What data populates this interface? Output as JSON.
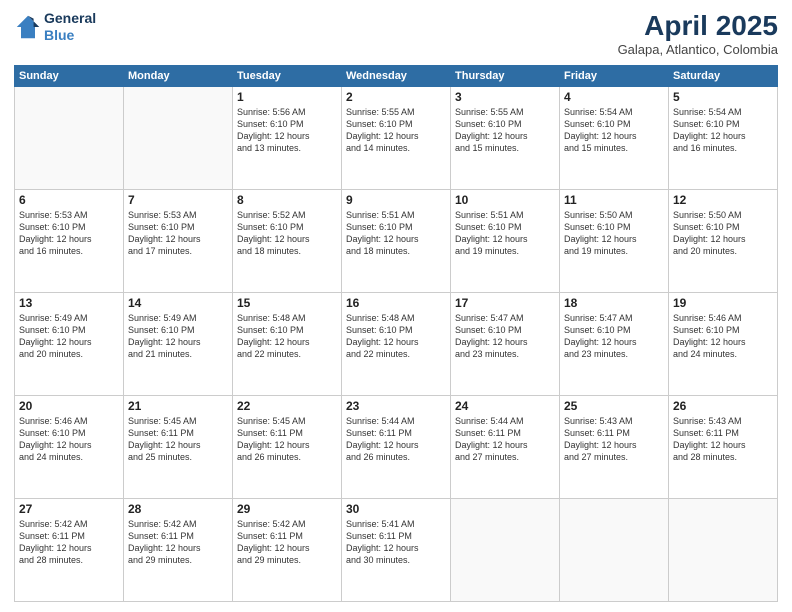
{
  "header": {
    "logo_line1": "General",
    "logo_line2": "Blue",
    "month": "April 2025",
    "location": "Galapa, Atlantico, Colombia"
  },
  "days_of_week": [
    "Sunday",
    "Monday",
    "Tuesday",
    "Wednesday",
    "Thursday",
    "Friday",
    "Saturday"
  ],
  "weeks": [
    [
      {
        "day": "",
        "info": ""
      },
      {
        "day": "",
        "info": ""
      },
      {
        "day": "1",
        "info": "Sunrise: 5:56 AM\nSunset: 6:10 PM\nDaylight: 12 hours\nand 13 minutes."
      },
      {
        "day": "2",
        "info": "Sunrise: 5:55 AM\nSunset: 6:10 PM\nDaylight: 12 hours\nand 14 minutes."
      },
      {
        "day": "3",
        "info": "Sunrise: 5:55 AM\nSunset: 6:10 PM\nDaylight: 12 hours\nand 15 minutes."
      },
      {
        "day": "4",
        "info": "Sunrise: 5:54 AM\nSunset: 6:10 PM\nDaylight: 12 hours\nand 15 minutes."
      },
      {
        "day": "5",
        "info": "Sunrise: 5:54 AM\nSunset: 6:10 PM\nDaylight: 12 hours\nand 16 minutes."
      }
    ],
    [
      {
        "day": "6",
        "info": "Sunrise: 5:53 AM\nSunset: 6:10 PM\nDaylight: 12 hours\nand 16 minutes."
      },
      {
        "day": "7",
        "info": "Sunrise: 5:53 AM\nSunset: 6:10 PM\nDaylight: 12 hours\nand 17 minutes."
      },
      {
        "day": "8",
        "info": "Sunrise: 5:52 AM\nSunset: 6:10 PM\nDaylight: 12 hours\nand 18 minutes."
      },
      {
        "day": "9",
        "info": "Sunrise: 5:51 AM\nSunset: 6:10 PM\nDaylight: 12 hours\nand 18 minutes."
      },
      {
        "day": "10",
        "info": "Sunrise: 5:51 AM\nSunset: 6:10 PM\nDaylight: 12 hours\nand 19 minutes."
      },
      {
        "day": "11",
        "info": "Sunrise: 5:50 AM\nSunset: 6:10 PM\nDaylight: 12 hours\nand 19 minutes."
      },
      {
        "day": "12",
        "info": "Sunrise: 5:50 AM\nSunset: 6:10 PM\nDaylight: 12 hours\nand 20 minutes."
      }
    ],
    [
      {
        "day": "13",
        "info": "Sunrise: 5:49 AM\nSunset: 6:10 PM\nDaylight: 12 hours\nand 20 minutes."
      },
      {
        "day": "14",
        "info": "Sunrise: 5:49 AM\nSunset: 6:10 PM\nDaylight: 12 hours\nand 21 minutes."
      },
      {
        "day": "15",
        "info": "Sunrise: 5:48 AM\nSunset: 6:10 PM\nDaylight: 12 hours\nand 22 minutes."
      },
      {
        "day": "16",
        "info": "Sunrise: 5:48 AM\nSunset: 6:10 PM\nDaylight: 12 hours\nand 22 minutes."
      },
      {
        "day": "17",
        "info": "Sunrise: 5:47 AM\nSunset: 6:10 PM\nDaylight: 12 hours\nand 23 minutes."
      },
      {
        "day": "18",
        "info": "Sunrise: 5:47 AM\nSunset: 6:10 PM\nDaylight: 12 hours\nand 23 minutes."
      },
      {
        "day": "19",
        "info": "Sunrise: 5:46 AM\nSunset: 6:10 PM\nDaylight: 12 hours\nand 24 minutes."
      }
    ],
    [
      {
        "day": "20",
        "info": "Sunrise: 5:46 AM\nSunset: 6:10 PM\nDaylight: 12 hours\nand 24 minutes."
      },
      {
        "day": "21",
        "info": "Sunrise: 5:45 AM\nSunset: 6:11 PM\nDaylight: 12 hours\nand 25 minutes."
      },
      {
        "day": "22",
        "info": "Sunrise: 5:45 AM\nSunset: 6:11 PM\nDaylight: 12 hours\nand 26 minutes."
      },
      {
        "day": "23",
        "info": "Sunrise: 5:44 AM\nSunset: 6:11 PM\nDaylight: 12 hours\nand 26 minutes."
      },
      {
        "day": "24",
        "info": "Sunrise: 5:44 AM\nSunset: 6:11 PM\nDaylight: 12 hours\nand 27 minutes."
      },
      {
        "day": "25",
        "info": "Sunrise: 5:43 AM\nSunset: 6:11 PM\nDaylight: 12 hours\nand 27 minutes."
      },
      {
        "day": "26",
        "info": "Sunrise: 5:43 AM\nSunset: 6:11 PM\nDaylight: 12 hours\nand 28 minutes."
      }
    ],
    [
      {
        "day": "27",
        "info": "Sunrise: 5:42 AM\nSunset: 6:11 PM\nDaylight: 12 hours\nand 28 minutes."
      },
      {
        "day": "28",
        "info": "Sunrise: 5:42 AM\nSunset: 6:11 PM\nDaylight: 12 hours\nand 29 minutes."
      },
      {
        "day": "29",
        "info": "Sunrise: 5:42 AM\nSunset: 6:11 PM\nDaylight: 12 hours\nand 29 minutes."
      },
      {
        "day": "30",
        "info": "Sunrise: 5:41 AM\nSunset: 6:11 PM\nDaylight: 12 hours\nand 30 minutes."
      },
      {
        "day": "",
        "info": ""
      },
      {
        "day": "",
        "info": ""
      },
      {
        "day": "",
        "info": ""
      }
    ]
  ]
}
